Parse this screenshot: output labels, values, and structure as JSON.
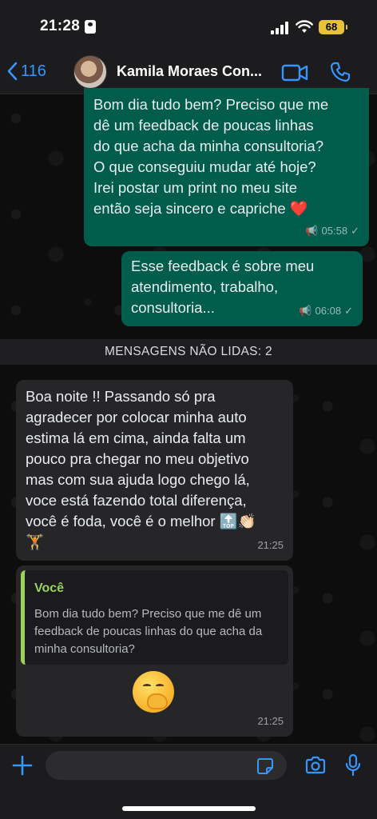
{
  "status_bar": {
    "time": "21:28",
    "battery": "68"
  },
  "header": {
    "back_count": "116",
    "contact_name": "Kamila Moraes Con..."
  },
  "messages": {
    "m1": {
      "text": "Bom dia tudo bem? Preciso que me\ndê um feedback de poucas linhas\ndo que acha da minha consultoria?\nO que conseguiu mudar até hoje?\nIrei postar um print no meu site\nentão seja sincero e capriche ❤️",
      "time": "05:58"
    },
    "m2": {
      "text": "Esse feedback é sobre meu\natendimento, trabalho,\nconsultoria...",
      "time": "06:08"
    },
    "unread_divider": "MENSAGENS NÃO LIDAS: 2",
    "m3": {
      "text": "Boa noite !! Passando só pra\nagradecer por colocar minha auto\nestima lá em cima, ainda falta um\npouco pra chegar no meu objetivo\nmas com sua ajuda logo chego lá,\nvoce está fazendo total diferença,\nvocê é foda, você é o melhor 🔝👏🏻\n🏋️",
      "time": "21:25"
    },
    "m4": {
      "quote_author": "Você",
      "quote_text": "Bom dia tudo bem? Preciso que me dê um\nfeedback de poucas linhas do que acha da\nminha consultoria?",
      "time": "21:25"
    }
  },
  "composer": {
    "placeholder": ""
  },
  "colors": {
    "accent": "#3596ff",
    "outgoing_bubble": "#005c4b",
    "incoming_bubble": "#262628",
    "quote_bar": "#9bd25a"
  }
}
